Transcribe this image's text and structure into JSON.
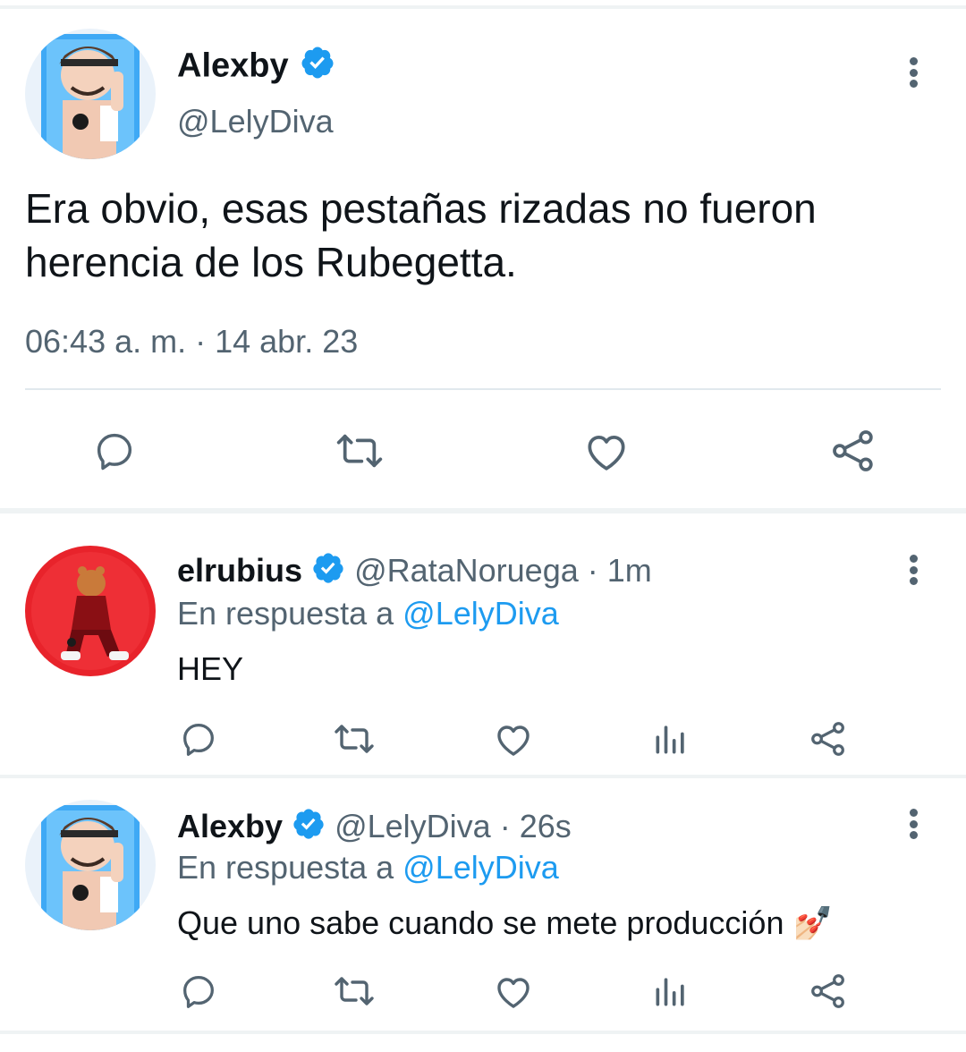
{
  "main_tweet": {
    "display_name": "Alexby",
    "handle": "@LelyDiva",
    "text_line1": "Era obvio, esas pestañas rizadas no fueron",
    "text_line2": "herencia de los Rubegetta.",
    "timestamp": "06:43 a. m. · 14 abr. 23",
    "verified": true,
    "actions": [
      "reply-icon",
      "retweet-icon",
      "like-icon",
      "share-icon"
    ]
  },
  "replies": [
    {
      "display_name": "elrubius",
      "handle": "@RataNoruega",
      "time": "· 1m",
      "reply_prefix": "En respuesta a",
      "reply_to": "@LelyDiva",
      "text": "HEY",
      "verified": true
    },
    {
      "display_name": "Alexby",
      "handle": "@LelyDiva",
      "time": "· 26s",
      "reply_prefix": "En respuesta a",
      "reply_to": "@LelyDiva",
      "text": "Que uno sabe cuando se mete producción 💅🏻",
      "verified": true
    }
  ],
  "colors": {
    "accent": "#1d9bf0",
    "muted": "#536471",
    "divider": "#eff3f4",
    "verified": "#1d9bf0"
  }
}
